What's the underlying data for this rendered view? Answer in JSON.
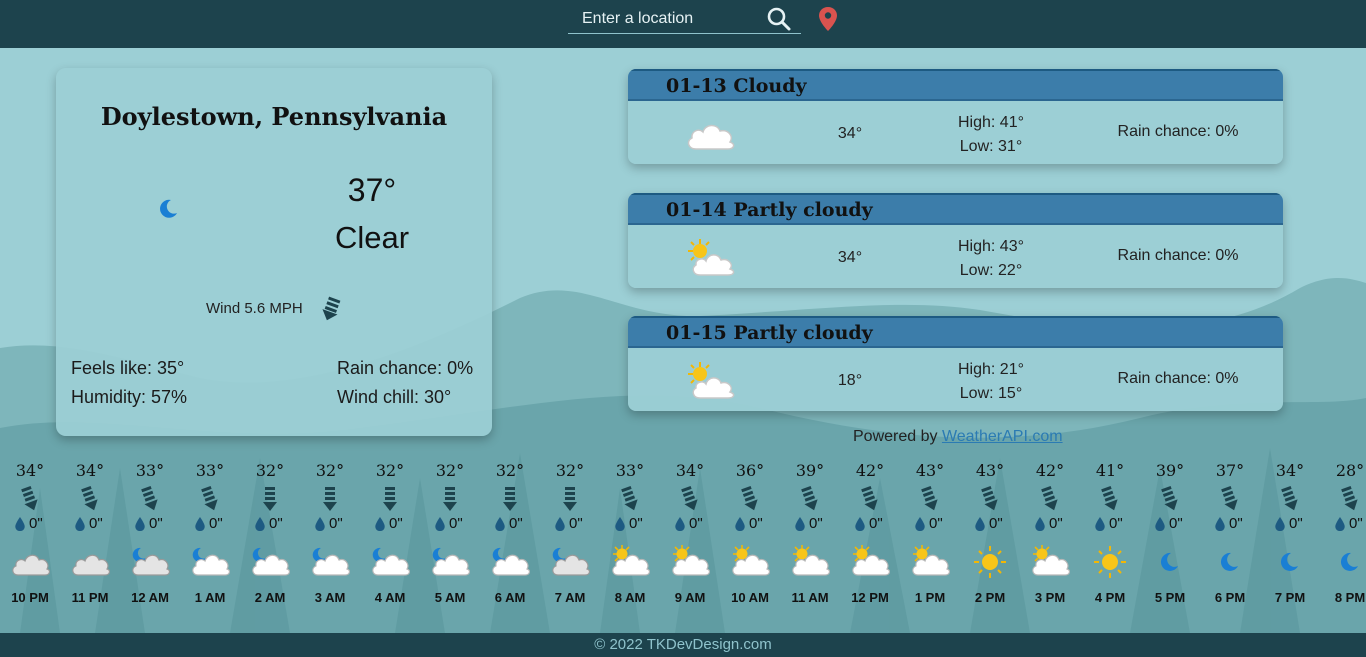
{
  "search": {
    "placeholder": "Enter a location"
  },
  "current": {
    "city": "Doylestown, Pennsylvania",
    "temp": "37°",
    "condition": "Clear",
    "wind": "Wind 5.6 MPH",
    "feels_like": "Feels like: 35°",
    "humidity": "Humidity: 57%",
    "rain_chance": "Rain chance: 0%",
    "wind_chill": "Wind chill: 30°",
    "icon": "moon-icon"
  },
  "forecast": [
    {
      "title": "01-13 Cloudy",
      "avg": "34°",
      "high": "High: 41°",
      "low": "Low: 31°",
      "rain": "Rain chance: 0%",
      "icon": "cloud-icon"
    },
    {
      "title": "01-14 Partly cloudy",
      "avg": "34°",
      "high": "High: 43°",
      "low": "Low: 22°",
      "rain": "Rain chance: 0%",
      "icon": "partly-cloudy-icon"
    },
    {
      "title": "01-15 Partly cloudy",
      "avg": "18°",
      "high": "High: 21°",
      "low": "Low: 15°",
      "rain": "Rain chance: 0%",
      "icon": "partly-cloudy-icon"
    }
  ],
  "powered": {
    "prefix": "Powered by ",
    "link": "WeatherAPI.com"
  },
  "hourly": [
    {
      "temp": "34°",
      "rain": "0\"",
      "time": "10 PM",
      "icon": "cloud"
    },
    {
      "temp": "34°",
      "rain": "0\"",
      "time": "11 PM",
      "icon": "cloud"
    },
    {
      "temp": "33°",
      "rain": "0\"",
      "time": "12 AM",
      "icon": "moon-cloud"
    },
    {
      "temp": "33°",
      "rain": "0\"",
      "time": "1 AM",
      "icon": "moon-cloud-light"
    },
    {
      "temp": "32°",
      "rain": "0\"",
      "time": "2 AM",
      "icon": "moon-cloud-light"
    },
    {
      "temp": "32°",
      "rain": "0\"",
      "time": "3 AM",
      "icon": "moon-cloud-light"
    },
    {
      "temp": "32°",
      "rain": "0\"",
      "time": "4 AM",
      "icon": "moon-cloud-light"
    },
    {
      "temp": "32°",
      "rain": "0\"",
      "time": "5 AM",
      "icon": "moon-cloud-light"
    },
    {
      "temp": "32°",
      "rain": "0\"",
      "time": "6 AM",
      "icon": "moon-cloud-light"
    },
    {
      "temp": "32°",
      "rain": "0\"",
      "time": "7 AM",
      "icon": "moon-cloud"
    },
    {
      "temp": "33°",
      "rain": "0\"",
      "time": "8 AM",
      "icon": "sun-cloud"
    },
    {
      "temp": "34°",
      "rain": "0\"",
      "time": "9 AM",
      "icon": "sun-cloud"
    },
    {
      "temp": "36°",
      "rain": "0\"",
      "time": "10 AM",
      "icon": "sun-cloud"
    },
    {
      "temp": "39°",
      "rain": "0\"",
      "time": "11 AM",
      "icon": "sun-cloud"
    },
    {
      "temp": "42°",
      "rain": "0\"",
      "time": "12 PM",
      "icon": "sun-cloud"
    },
    {
      "temp": "43°",
      "rain": "0\"",
      "time": "1 PM",
      "icon": "sun-cloud"
    },
    {
      "temp": "43°",
      "rain": "0\"",
      "time": "2 PM",
      "icon": "sun"
    },
    {
      "temp": "42°",
      "rain": "0\"",
      "time": "3 PM",
      "icon": "sun-cloud"
    },
    {
      "temp": "41°",
      "rain": "0\"",
      "time": "4 PM",
      "icon": "sun"
    },
    {
      "temp": "39°",
      "rain": "0\"",
      "time": "5 PM",
      "icon": "moon"
    },
    {
      "temp": "37°",
      "rain": "0\"",
      "time": "6 PM",
      "icon": "moon"
    },
    {
      "temp": "34°",
      "rain": "0\"",
      "time": "7 PM",
      "icon": "moon"
    },
    {
      "temp": "28°",
      "rain": "0\"",
      "time": "8 PM",
      "icon": "moon"
    }
  ],
  "footer": "© 2022 TKDevDesign.com",
  "colors": {
    "header": "#1d434d",
    "background": "#9ccfd5",
    "forecast_header": "#3c7daa",
    "link": "#2b7bb3",
    "pin": "#d9534f",
    "moon": "#1a7fd4"
  }
}
